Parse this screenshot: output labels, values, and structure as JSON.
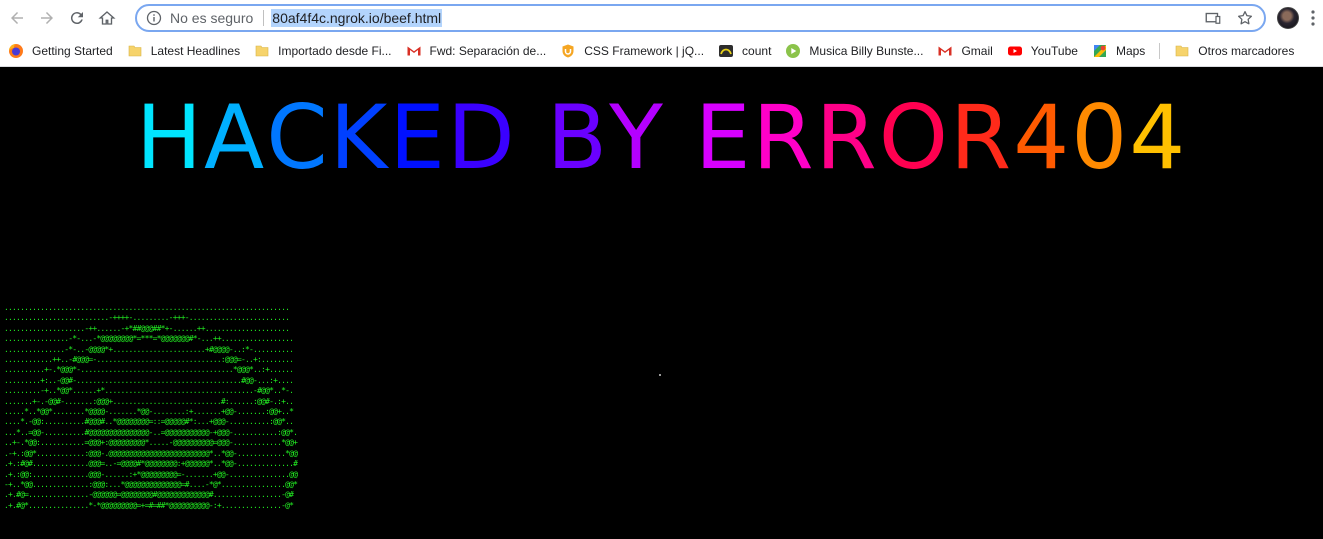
{
  "toolbar": {
    "security_label": "No es seguro",
    "url": "80af4f4c.ngrok.io/beef.html"
  },
  "bookmarks": [
    {
      "label": "Getting Started",
      "icon": "firefox-icon"
    },
    {
      "label": "Latest Headlines",
      "icon": "folder-icon"
    },
    {
      "label": "Importado desde Fi...",
      "icon": "folder-icon"
    },
    {
      "label": "Fwd: Separación de...",
      "icon": "gmail-icon"
    },
    {
      "label": "CSS Framework | jQ...",
      "icon": "shield-icon"
    },
    {
      "label": "count",
      "icon": "count-icon"
    },
    {
      "label": "Musica Billy Bunste...",
      "icon": "play-icon"
    },
    {
      "label": "Gmail",
      "icon": "gmail-icon"
    },
    {
      "label": "YouTube",
      "icon": "youtube-icon"
    },
    {
      "label": "Maps",
      "icon": "maps-icon"
    },
    {
      "label": "Otros marcadores",
      "icon": "folder-icon"
    }
  ],
  "page": {
    "title": "HACKED BY ERROR404",
    "ascii_art": ".......................................................................\n..........................-++++-.........-+++-.........................\n....................-++......-+*##@@@##*+-......++.....................\n................-*-...-*@@@@@@@@*=***=*@@@@@@@#*-...++..................\n...............-*-..-@@@@*+.......................+#@@@@-..:*-..........\n............++..-#@@@=-...............................:@@@=-..+:........\n..........+-.*@@@*-......................................*@@@*..:+......\n.........+:..-@@#-.........................................#@@-...:+....\n.........-+..*@@*......+*.....................................-#@@*..*-.\n.......+-.-@@#-.......:@@@+...........................#:......:@@#-.:+..\n.....*..*@@*........*@@@@-.......*@@-........:+.......+@@-.......:@@+..*\n....*.-@@:..........#@@@#..*@@@@@@@@=::=@@@@@#*:...+@@@-..........:@@*..\n...*..=@@-..........#@@@@@@@@@@@@@@@-..=@@@@@@@@@@@-+@@@-...........:@@*.\n..+-.*@@:...........=@@@+:@@@@@@@@@*.....-@@@@@@@@@@=@@@-............*@@+\n.-+.:@@*............:@@@-.@@@@@@@@@@@@@@@@@@@@@@@@@*..*@@-............*@@\n.+.:#@#..............@@@=..-=@@@@#*@@@@@@@@:+@@@@@@*..*@@-..............#\n.+.:@@:..............@@@-......:+*@@@@@@@@@=-.......+@@-...............@@\n-+..*@@..............:@@@:...*@@@@@@@@@@@@@@=#....-*@*................@@*\n.+.#@=...............-@@@@@@=@@@@@@@@#@@@@@@@@@@@@@#.................-@#\n.+.#@*...............*-*@@@@@@@@@=+=#=##*@@@@@@@@@@-:+...............-@*"
  },
  "colors": {
    "letters": [
      "#00e5ff",
      "#00b0ff",
      "#0077ff",
      "#0040ff",
      "#0010ff",
      "#3a00ff",
      "#6a00ff",
      "#b400ff",
      "#d800ff",
      "#ff00c8",
      "#ff0088",
      "#ff0050",
      "#ff2a1a",
      "#ff5a00",
      "#ff8a00",
      "#ffc000",
      "#e0ff00",
      "#a8ff00"
    ],
    "ascii": "#22ee22",
    "omnibox_border": "#7aa7f0",
    "url_highlight": "#b3d4fc"
  }
}
